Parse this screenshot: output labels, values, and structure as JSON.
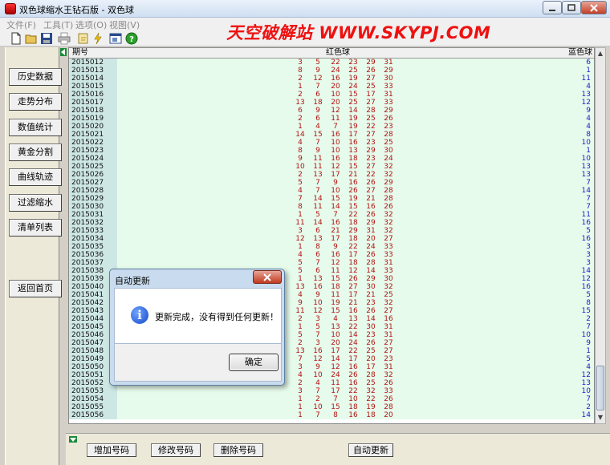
{
  "window": {
    "title": "双色球缩水王钻石版 - 双色球",
    "min": "0",
    "max": "1",
    "close": "r"
  },
  "menu": [
    "文件(F)",
    "工具(T)",
    "选项(O)",
    "视图(V)"
  ],
  "watermark": "天空破解站 WWW.SKYPJ.COM",
  "toolbar": {
    "icons": [
      "new-file-icon",
      "open-folder-icon",
      "save-icon",
      "print-icon",
      "key-icon",
      "lightning-icon",
      "window-icon",
      "help-icon"
    ]
  },
  "sidebar": {
    "items": [
      "历史数据",
      "走势分布",
      "数值统计",
      "黄金分割",
      "曲线轨迹",
      "过滤缩水",
      "清单列表",
      "返回首页"
    ]
  },
  "grid": {
    "headers": {
      "period": "期号",
      "red": "红色球",
      "blue": "蓝色球"
    },
    "rows": [
      {
        "period": "2015012",
        "reds": [
          "3",
          "5",
          "22",
          "23",
          "29",
          "31"
        ],
        "blue": "6"
      },
      {
        "period": "2015013",
        "reds": [
          "8",
          "9",
          "24",
          "25",
          "26",
          "29"
        ],
        "blue": "1"
      },
      {
        "period": "2015014",
        "reds": [
          "2",
          "12",
          "16",
          "19",
          "27",
          "30"
        ],
        "blue": "11"
      },
      {
        "period": "2015015",
        "reds": [
          "1",
          "7",
          "20",
          "24",
          "25",
          "33"
        ],
        "blue": "4"
      },
      {
        "period": "2015016",
        "reds": [
          "2",
          "6",
          "10",
          "15",
          "17",
          "31"
        ],
        "blue": "13"
      },
      {
        "period": "2015017",
        "reds": [
          "13",
          "18",
          "20",
          "25",
          "27",
          "33"
        ],
        "blue": "12"
      },
      {
        "period": "2015018",
        "reds": [
          "6",
          "9",
          "12",
          "14",
          "28",
          "29"
        ],
        "blue": "9"
      },
      {
        "period": "2015019",
        "reds": [
          "2",
          "6",
          "11",
          "19",
          "25",
          "26"
        ],
        "blue": "4"
      },
      {
        "period": "2015020",
        "reds": [
          "1",
          "4",
          "7",
          "19",
          "22",
          "23"
        ],
        "blue": "4"
      },
      {
        "period": "2015021",
        "reds": [
          "14",
          "15",
          "16",
          "17",
          "27",
          "28"
        ],
        "blue": "8"
      },
      {
        "period": "2015022",
        "reds": [
          "4",
          "7",
          "10",
          "16",
          "23",
          "25"
        ],
        "blue": "10"
      },
      {
        "period": "2015023",
        "reds": [
          "8",
          "9",
          "10",
          "13",
          "29",
          "30"
        ],
        "blue": "1"
      },
      {
        "period": "2015024",
        "reds": [
          "9",
          "11",
          "16",
          "18",
          "23",
          "24"
        ],
        "blue": "10"
      },
      {
        "period": "2015025",
        "reds": [
          "10",
          "11",
          "12",
          "15",
          "27",
          "32"
        ],
        "blue": "13"
      },
      {
        "period": "2015026",
        "reds": [
          "2",
          "13",
          "17",
          "21",
          "22",
          "32"
        ],
        "blue": "13"
      },
      {
        "period": "2015027",
        "reds": [
          "5",
          "7",
          "9",
          "16",
          "26",
          "29"
        ],
        "blue": "7"
      },
      {
        "period": "2015028",
        "reds": [
          "4",
          "7",
          "10",
          "26",
          "27",
          "28"
        ],
        "blue": "14"
      },
      {
        "period": "2015029",
        "reds": [
          "7",
          "14",
          "15",
          "19",
          "21",
          "28"
        ],
        "blue": "7"
      },
      {
        "period": "2015030",
        "reds": [
          "8",
          "11",
          "14",
          "15",
          "16",
          "26"
        ],
        "blue": "7"
      },
      {
        "period": "2015031",
        "reds": [
          "1",
          "5",
          "7",
          "22",
          "26",
          "32"
        ],
        "blue": "11"
      },
      {
        "period": "2015032",
        "reds": [
          "11",
          "14",
          "16",
          "18",
          "29",
          "32"
        ],
        "blue": "16"
      },
      {
        "period": "2015033",
        "reds": [
          "3",
          "6",
          "21",
          "29",
          "31",
          "32"
        ],
        "blue": "5"
      },
      {
        "period": "2015034",
        "reds": [
          "12",
          "13",
          "17",
          "18",
          "20",
          "27"
        ],
        "blue": "16"
      },
      {
        "period": "2015035",
        "reds": [
          "1",
          "8",
          "9",
          "22",
          "24",
          "33"
        ],
        "blue": "3"
      },
      {
        "period": "2015036",
        "reds": [
          "4",
          "6",
          "16",
          "17",
          "26",
          "33"
        ],
        "blue": "3"
      },
      {
        "period": "2015037",
        "reds": [
          "5",
          "7",
          "12",
          "18",
          "28",
          "31"
        ],
        "blue": "3"
      },
      {
        "period": "2015038",
        "reds": [
          "5",
          "6",
          "11",
          "12",
          "14",
          "33"
        ],
        "blue": "14"
      },
      {
        "period": "2015039",
        "reds": [
          "1",
          "13",
          "15",
          "26",
          "29",
          "30"
        ],
        "blue": "12"
      },
      {
        "period": "2015040",
        "reds": [
          "13",
          "16",
          "18",
          "27",
          "30",
          "32"
        ],
        "blue": "16"
      },
      {
        "period": "2015041",
        "reds": [
          "4",
          "9",
          "11",
          "17",
          "21",
          "25"
        ],
        "blue": "5"
      },
      {
        "period": "2015042",
        "reds": [
          "9",
          "10",
          "19",
          "21",
          "23",
          "32"
        ],
        "blue": "8"
      },
      {
        "period": "2015043",
        "reds": [
          "11",
          "12",
          "15",
          "16",
          "26",
          "27"
        ],
        "blue": "15"
      },
      {
        "period": "2015044",
        "reds": [
          "2",
          "3",
          "4",
          "13",
          "14",
          "16"
        ],
        "blue": "2"
      },
      {
        "period": "2015045",
        "reds": [
          "1",
          "5",
          "13",
          "22",
          "30",
          "31"
        ],
        "blue": "7"
      },
      {
        "period": "2015046",
        "reds": [
          "5",
          "7",
          "10",
          "14",
          "23",
          "31"
        ],
        "blue": "10"
      },
      {
        "period": "2015047",
        "reds": [
          "2",
          "3",
          "20",
          "24",
          "26",
          "27"
        ],
        "blue": "9"
      },
      {
        "period": "2015048",
        "reds": [
          "13",
          "16",
          "17",
          "22",
          "25",
          "27"
        ],
        "blue": "1"
      },
      {
        "period": "2015049",
        "reds": [
          "7",
          "12",
          "14",
          "17",
          "20",
          "23"
        ],
        "blue": "5"
      },
      {
        "period": "2015050",
        "reds": [
          "3",
          "9",
          "12",
          "16",
          "17",
          "31"
        ],
        "blue": "4"
      },
      {
        "period": "2015051",
        "reds": [
          "4",
          "10",
          "24",
          "26",
          "28",
          "32"
        ],
        "blue": "12"
      },
      {
        "period": "2015052",
        "reds": [
          "2",
          "4",
          "11",
          "16",
          "25",
          "26"
        ],
        "blue": "13"
      },
      {
        "period": "2015053",
        "reds": [
          "3",
          "7",
          "17",
          "22",
          "32",
          "33"
        ],
        "blue": "10"
      },
      {
        "period": "2015054",
        "reds": [
          "1",
          "2",
          "7",
          "10",
          "22",
          "26"
        ],
        "blue": "7"
      },
      {
        "period": "2015055",
        "reds": [
          "1",
          "10",
          "15",
          "18",
          "19",
          "28"
        ],
        "blue": "2"
      },
      {
        "period": "2015056",
        "reds": [
          "1",
          "7",
          "8",
          "16",
          "18",
          "20"
        ],
        "blue": "14"
      }
    ]
  },
  "bottom": {
    "add": "增加号码",
    "edit": "修改号码",
    "delete": "删除号码",
    "auto_update": "自动更新"
  },
  "dialog": {
    "title": "自动更新",
    "message": "更新完成，没有得到任何更新！",
    "ok": "确定",
    "icon": "info-icon",
    "close": "x"
  },
  "colors": {
    "red_ball": "#b21212",
    "blue_ball": "#1d1dcc",
    "watermark": "#ee1111"
  }
}
